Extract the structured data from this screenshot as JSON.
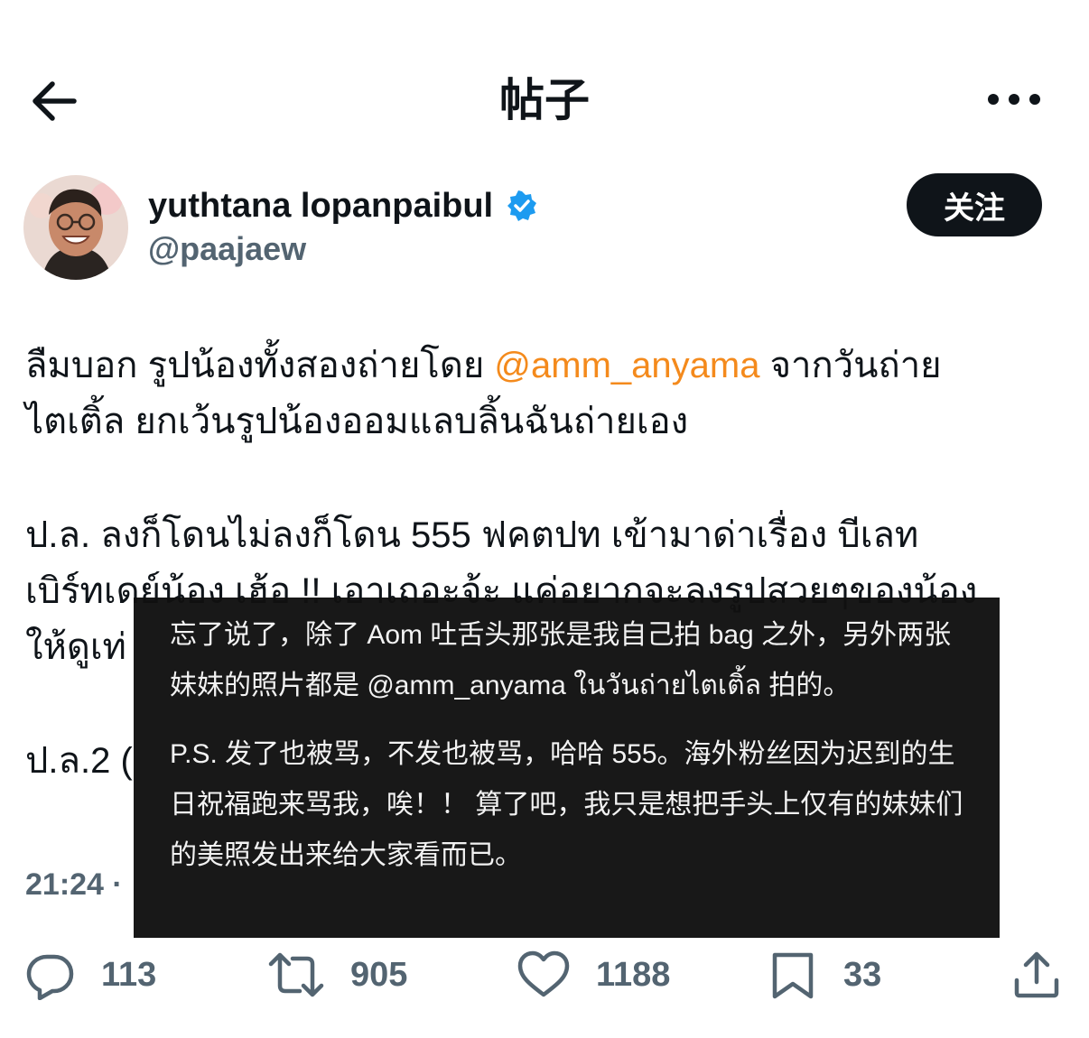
{
  "header": {
    "title": "帖子"
  },
  "author": {
    "name": "yuthtana lopanpaibul",
    "handle": "@paajaew",
    "verified": true,
    "follow_label": "关注"
  },
  "tweet": {
    "lines": {
      "l1_a": "ลืมบอก รูปน้องทั้งสองถ่ายโดย ",
      "l1_mention": "@amm_anyama",
      "l1_b": "  จากวันถ่าย",
      "l2": "ไตเติ้ล  ยกเว้นรูปน้องออมแลบลิ้นฉันถ่ายเอง",
      "l3": "ป.ล. ลงก็โดนไม่ลงก็โดน 555 ฟคตปท  เข้ามาด่าเรื่อง บีเลท",
      "l4": "เบิร์ทเดย์น้อง  เฮ้อ !! เอาเถอะจ้ะ  แค่อยากจะลงรูปสวยๆของน้อง",
      "l5": "ให้ดูเท่",
      "l6": "ป.ล.2 ("
    },
    "timestamp": "21:24 ·"
  },
  "translation": {
    "p1": "忘了说了，除了 Aom 吐舌头那张是我自己拍 bag 之外，另外两张妹妹的照片都是 @amm_anyama ในวันถ่ายไตเติ้ล 拍的。",
    "p2": "P.S. 发了也被骂，不发也被骂，哈哈 555。海外粉丝因为迟到的生日祝福跑来骂我，唉！！ 算了吧，我只是想把手头上仅有的妹妹们的美照发出来给大家看而已。"
  },
  "actions": {
    "reply_count": "113",
    "retweet_count": "905",
    "like_count": "1188",
    "bookmark_count": "33"
  },
  "colors": {
    "mention": "#f48a1c",
    "verified": "#1d9bf0",
    "muted": "#536471",
    "follow_bg": "#0f1419"
  },
  "icons": [
    "back-arrow-icon",
    "more-icon",
    "verified-icon",
    "reply-icon",
    "retweet-icon",
    "like-icon",
    "bookmark-icon",
    "share-icon"
  ]
}
